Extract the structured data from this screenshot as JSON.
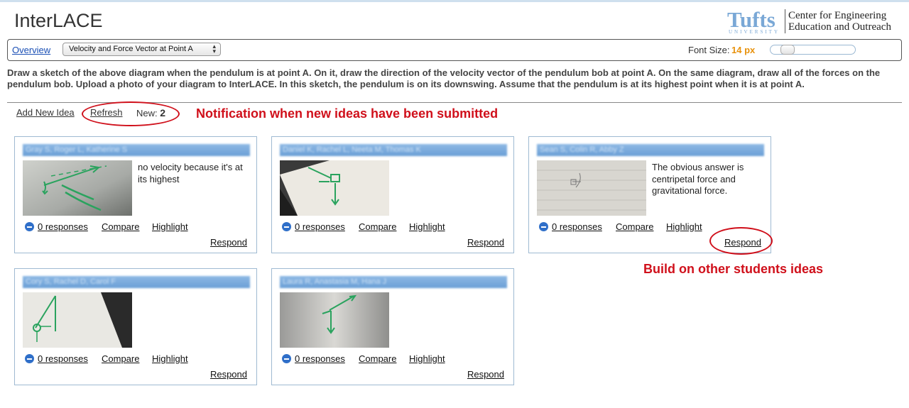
{
  "app": {
    "title": "InterLACE"
  },
  "logo": {
    "word": "Tufts",
    "sub": "UNIVERSITY",
    "center_line1": "Center for Engineering",
    "center_line2": "Education and Outreach",
    "color": "#7aa8d6"
  },
  "toolbar": {
    "overview_label": "Overview",
    "question_selected": "Velocity and Force Vector at Point A",
    "font_size_label": "Font Size:",
    "font_size_value": "14 px",
    "font_slider_level": 0.2
  },
  "prompt": "Draw a sketch of the above diagram when the pendulum is at point A. On it, draw the direction of the velocity vector of the pendulum bob at point A. On the same diagram, draw all of the forces on the pendulum bob. Upload a photo of your diagram to InterLACE. In this sketch, the pendulum is on its downswing. Assume that the pendulum is at its highest point when it is at point A.",
  "ideas_bar": {
    "add_label": "Add New Idea",
    "refresh_label": "Refresh",
    "new_label": "New:",
    "new_count": "2"
  },
  "annotations": {
    "notification": "Notification when new ideas have been submitted",
    "build": "Build on other students ideas",
    "color": "#d0101b"
  },
  "cards": [
    {
      "author": "Gray S, Roger L, Katherine S",
      "text": "no velocity because it's at its highest",
      "responses": "0 responses",
      "compare": "Compare",
      "highlight": "Highlight",
      "respond": "Respond"
    },
    {
      "author": "Daniel K, Rachel L, Neeta M, Thomas K",
      "text": "",
      "responses": "0 responses",
      "compare": "Compare",
      "highlight": "Highlight",
      "respond": "Respond"
    },
    {
      "author": "Sean S, Colin R, Abby Z",
      "text": "The obvious answer is centripetal force and gravitational force.",
      "responses": "0 responses",
      "compare": "Compare",
      "highlight": "Highlight",
      "respond": "Respond"
    },
    {
      "author": "Cory S, Rachel D, Carol F",
      "text": "",
      "responses": "0 responses",
      "compare": "Compare",
      "highlight": "Highlight",
      "respond": "Respond"
    },
    {
      "author": "Laura R, Anastasia M, Hana J",
      "text": "",
      "responses": "0 responses",
      "compare": "Compare",
      "highlight": "Highlight",
      "respond": "Respond"
    }
  ]
}
